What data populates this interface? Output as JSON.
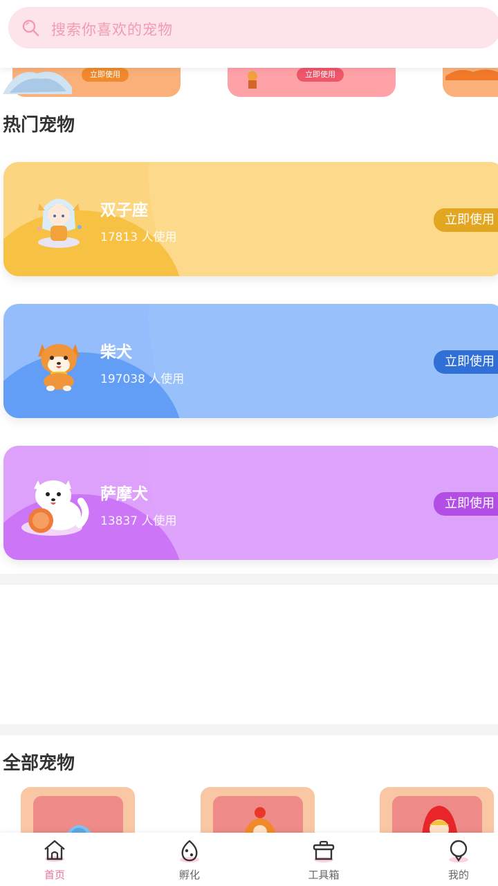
{
  "search": {
    "placeholder": "搜索你喜欢的宠物"
  },
  "carousel": {
    "items": [
      {
        "button": "立即使用"
      },
      {
        "button": "立即使用"
      }
    ]
  },
  "hot_section": {
    "title": "热门宠物",
    "pets": [
      {
        "name": "双子座",
        "usage": "17813 人使用",
        "button": "立即使用"
      },
      {
        "name": "柴犬",
        "usage": "197038 人使用",
        "button": "立即使用"
      },
      {
        "name": "萨摩犬",
        "usage": "13837 人使用",
        "button": "立即使用"
      }
    ]
  },
  "all_section": {
    "title": "全部宠物"
  },
  "bottom_nav": {
    "items": [
      {
        "label": "首页",
        "icon": "home-icon",
        "active": true
      },
      {
        "label": "孵化",
        "icon": "egg-icon",
        "active": false
      },
      {
        "label": "工具箱",
        "icon": "toolbox-icon",
        "active": false
      },
      {
        "label": "我的",
        "icon": "profile-icon",
        "active": false
      }
    ]
  },
  "colors": {
    "accent_pink": "#f0709a",
    "card_yellow": "#fcd581",
    "card_blue": "#95bdfb",
    "card_purple": "#dda0fb"
  }
}
